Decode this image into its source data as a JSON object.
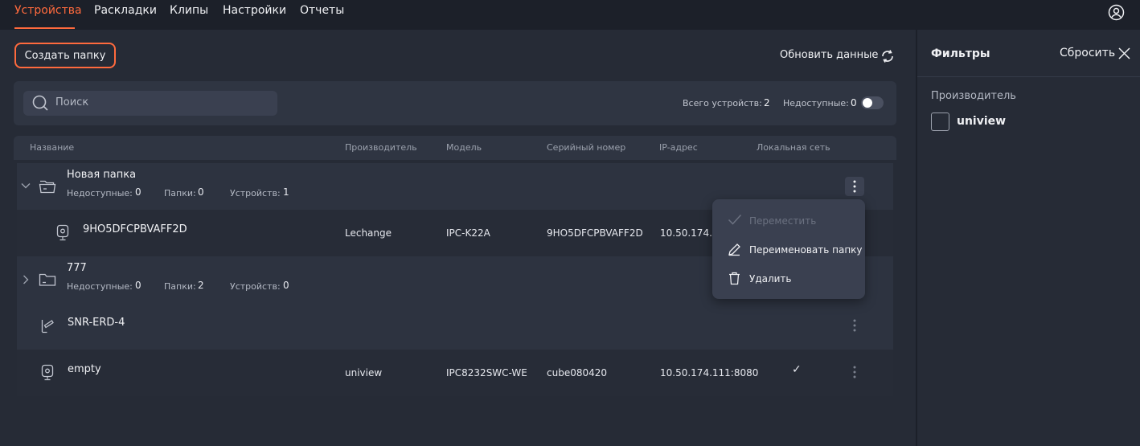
{
  "tabs": [
    {
      "label": "Устройства",
      "active": true
    },
    {
      "label": "Раскладки"
    },
    {
      "label": "Клипы"
    },
    {
      "label": "Настройки"
    },
    {
      "label": "Отчеты"
    }
  ],
  "toolbar": {
    "create_folder": "Создать папку",
    "refresh": "Обновить данные"
  },
  "search": {
    "placeholder": "Поиск"
  },
  "stats": {
    "total_label": "Всего устройств:",
    "total_value": "2",
    "unavailable_label": "Недоступные:",
    "unavailable_value": "0"
  },
  "table": {
    "columns": [
      "Название",
      "Производитель",
      "Модель",
      "Серийный номер",
      "IP-адрес",
      "Локальная сеть"
    ]
  },
  "rows": {
    "folder1": {
      "name": "Новая папка",
      "unavailable_label": "Недоступные:",
      "unavailable": "0",
      "folders_label": "Папки:",
      "folders": "0",
      "devices_label": "Устройств:",
      "devices": "1"
    },
    "device1": {
      "name": "9HO5DFCPBVAFF2D",
      "manufacturer": "Lechange",
      "model": "IPC-K22A",
      "serial": "9HO5DFCPBVAFF2D",
      "ip": "10.50.174.198"
    },
    "folder2": {
      "name": "777",
      "unavailable_label": "Недоступные:",
      "unavailable": "0",
      "folders_label": "Папки:",
      "folders": "2",
      "devices_label": "Устройств:",
      "devices": "0"
    },
    "device2": {
      "name": "SNR-ERD-4"
    },
    "device3": {
      "name": "empty",
      "manufacturer": "uniview",
      "model": "IPC8232SWC-WE",
      "serial": "cube080420",
      "ip": "10.50.174.111:8080",
      "local_network": "✓"
    }
  },
  "context_menu": {
    "move": "Переместить",
    "rename": "Переименовать папку",
    "delete": "Удалить"
  },
  "filters": {
    "title": "Фильтры",
    "reset": "Сбросить",
    "manufacturer_label": "Производитель",
    "manufacturer_option": "uniview"
  },
  "colors": {
    "accent": "#ff6a3d",
    "background": "#262b36",
    "topbar": "#1c2029"
  }
}
